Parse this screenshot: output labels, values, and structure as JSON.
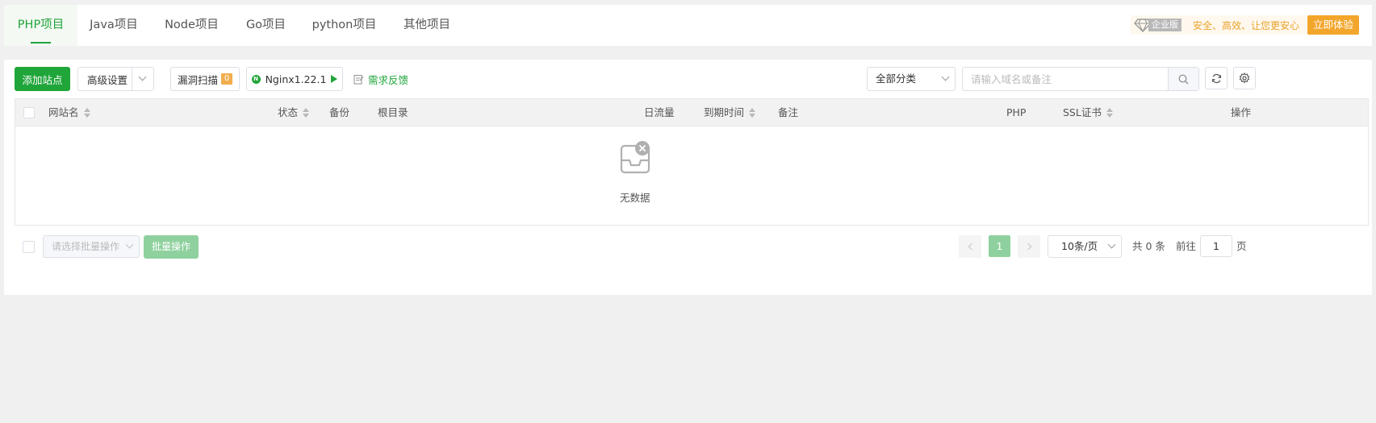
{
  "tabs": [
    {
      "label": "PHP项目",
      "active": true
    },
    {
      "label": "Java项目",
      "active": false
    },
    {
      "label": "Node项目",
      "active": false
    },
    {
      "label": "Go项目",
      "active": false
    },
    {
      "label": "python项目",
      "active": false
    },
    {
      "label": "其他项目",
      "active": false
    }
  ],
  "promo": {
    "edition": "企业版",
    "slogan": "安全、高效、让您更安心",
    "button": "立即体验"
  },
  "toolbar": {
    "add_site": "添加站点",
    "advanced": "高级设置",
    "vuln_scan": "漏洞扫描",
    "vuln_count": "0",
    "nginx": "Nginx1.22.1",
    "feedback": "需求反馈",
    "category": "全部分类",
    "search_placeholder": "请输入域名或备注"
  },
  "table": {
    "columns": {
      "site_name": "网站名",
      "status": "状态",
      "backup": "备份",
      "root_dir": "根目录",
      "daily_traffic": "日流量",
      "expire": "到期时间",
      "note": "备注",
      "php": "PHP",
      "ssl": "SSL证书",
      "action": "操作"
    },
    "empty_text": "无数据",
    "rows": []
  },
  "footer": {
    "batch_placeholder": "请选择批量操作",
    "batch_button": "批量操作",
    "current_page": "1",
    "page_size": "10条/页",
    "total": "共 0 条",
    "goto_label": "前往",
    "goto_value": "1",
    "page_unit": "页"
  },
  "colors": {
    "accent": "#20a53a",
    "warning": "#f3a62c"
  }
}
